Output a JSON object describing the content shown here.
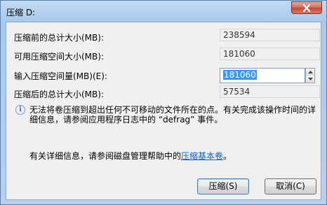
{
  "window": {
    "title": "压缩 D:",
    "close_label": "✕"
  },
  "fields": {
    "total_before": {
      "label": "压缩前的总计大小(MB):",
      "value": "238594"
    },
    "available": {
      "label": "可用压缩空间大小(MB):",
      "value": "181060"
    },
    "shrink_amount": {
      "label": "输入压缩空间量(MB)(E):",
      "value": "181060"
    },
    "total_after": {
      "label": "压缩后的总计大小(MB):",
      "value": "57534"
    }
  },
  "info": {
    "icon": "info-icon",
    "text": "无法将卷压缩到超出任何不可移动的文件所在的点。有关完成该操作时间的详细信息，请参阅应用程序日志中的 “defrag” 事件。"
  },
  "details": {
    "prefix": "有关详细信息，请参阅磁盘管理帮助中的",
    "link": "压缩基本卷",
    "suffix": "。"
  },
  "buttons": {
    "shrink": "压缩(S)",
    "cancel": "取消(C)"
  }
}
